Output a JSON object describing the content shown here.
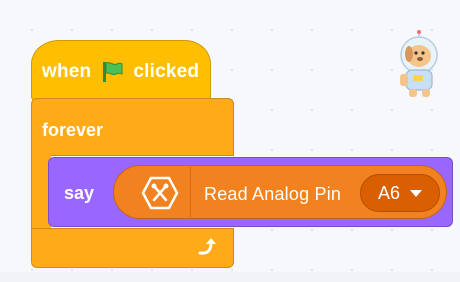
{
  "hat_block": {
    "label_when": "when",
    "label_clicked": "clicked",
    "icon": "green-flag-icon"
  },
  "forever_block": {
    "label": "forever",
    "loop_icon": "loop-arrow-icon"
  },
  "say_block": {
    "label": "say"
  },
  "reporter_block": {
    "icon": "arduino-extension-icon",
    "label": "Read Analog Pin",
    "pin_value": "A6"
  },
  "sprite": {
    "icon": "astronaut-dog-sprite"
  },
  "colors": {
    "events": "#ffbf00",
    "control": "#ffab19",
    "looks": "#9966ff",
    "extension": "#f2811f",
    "dropdown": "#d95f00",
    "flag": "#4cbf56"
  }
}
